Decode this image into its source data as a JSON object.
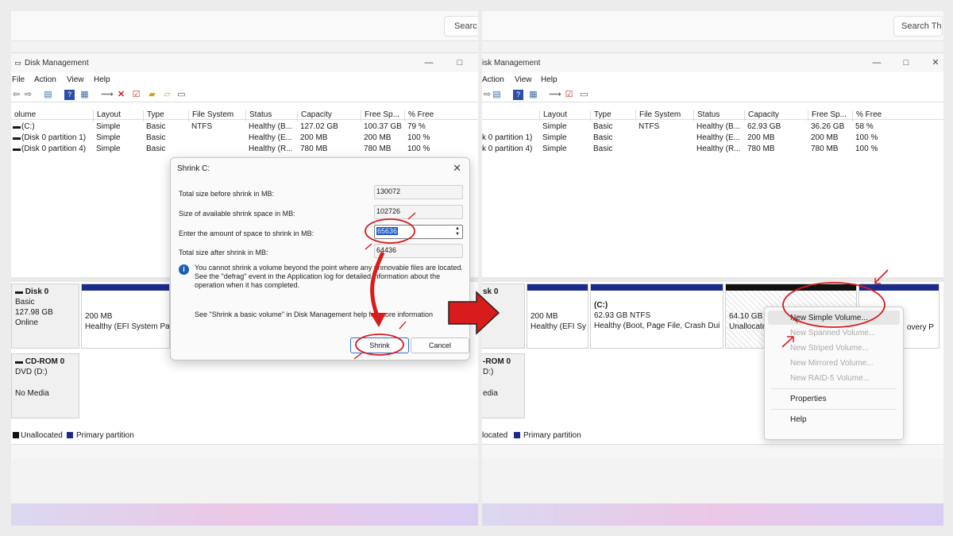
{
  "left": {
    "search_text": "Searc",
    "window_title": "Disk Management",
    "menu": [
      "File",
      "Action",
      "View",
      "Help"
    ],
    "columns": [
      "olume",
      "Layout",
      "Type",
      "File System",
      "Status",
      "Capacity",
      "Free Sp...",
      "% Free"
    ],
    "rows": [
      [
        "(C:)",
        "Simple",
        "Basic",
        "NTFS",
        "Healthy (B...",
        "127.02 GB",
        "100.37 GB",
        "79 %"
      ],
      [
        "(Disk 0 partition 1)",
        "Simple",
        "Basic",
        "",
        "Healthy (E...",
        "200 MB",
        "200 MB",
        "100 %"
      ],
      [
        "(Disk 0 partition 4)",
        "Simple",
        "Basic",
        "",
        "Healthy (R...",
        "780 MB",
        "780 MB",
        "100 %"
      ]
    ],
    "disk0": {
      "name": "Disk 0",
      "type": "Basic",
      "size": "127.98 GB",
      "state": "Online"
    },
    "cdrom": {
      "name": "CD-ROM 0",
      "type": "DVD (D:)",
      "state": "No Media"
    },
    "part1": {
      "size": "200 MB",
      "status": "Healthy (EFI System Pa"
    },
    "legend": {
      "unallocated": "Unallocated",
      "primary": "Primary partition"
    },
    "dialog": {
      "title": "Shrink C:",
      "total_before_label": "Total size before shrink in MB:",
      "total_before_value": "130072",
      "available_label": "Size of available shrink space in MB:",
      "available_value": "102726",
      "amount_label": "Enter the amount of space to shrink in MB:",
      "amount_value": "65636",
      "total_after_label": "Total size after shrink in MB:",
      "total_after_value": "64436",
      "info_text": "You cannot shrink a volume beyond the point where any unmovable files are located. See the \"defrag\" event in the Application log for detailed information about the operation when it has completed.",
      "help_text": "See \"Shrink a basic volume\" in Disk Management help for more information",
      "shrink_label": "Shrink",
      "cancel_label": "Cancel"
    }
  },
  "right": {
    "search_text": "Search Th",
    "window_title": "isk Management",
    "menu": [
      "Action",
      "View",
      "Help"
    ],
    "columns": [
      "Layout",
      "Type",
      "File System",
      "Status",
      "Capacity",
      "Free Sp...",
      "% Free"
    ],
    "rows": [
      [
        "",
        "Simple",
        "Basic",
        "NTFS",
        "Healthy (B...",
        "62.93 GB",
        "36.26 GB",
        "58 %"
      ],
      [
        "k 0 partition 1)",
        "Simple",
        "Basic",
        "",
        "Healthy (E...",
        "200 MB",
        "200 MB",
        "100 %"
      ],
      [
        "k 0 partition 4)",
        "Simple",
        "Basic",
        "",
        "Healthy (R...",
        "780 MB",
        "780 MB",
        "100 %"
      ]
    ],
    "disk0": {
      "name": "sk 0"
    },
    "cdrom": {
      "name": "-ROM 0",
      "type": "D:)",
      "state": "edia"
    },
    "part1": {
      "size": "200 MB",
      "status": "Healthy (EFI Sy"
    },
    "partc": {
      "name": "(C:)",
      "size": "62.93 GB NTFS",
      "status": "Healthy (Boot, Page File, Crash Dui"
    },
    "unalloc": {
      "size": "64.10 GB",
      "status": "Unallocate"
    },
    "part4": {
      "status": "overy P"
    },
    "legend": {
      "unallocated": "located",
      "primary": "Primary partition"
    },
    "context_menu": {
      "items": [
        "New Simple Volume...",
        "New Spanned Volume...",
        "New Striped Volume...",
        "New Mirrored Volume...",
        "New RAID-5 Volume..."
      ],
      "properties": "Properties",
      "help": "Help"
    }
  },
  "colors": {
    "primary_partition": "#1b2b8b",
    "annotation_red": "#d81b1b",
    "selection": "#1c57c8"
  },
  "icons": [
    "minimize-icon",
    "maximize-icon",
    "close-icon",
    "info-icon",
    "red-arrow-icon"
  ]
}
